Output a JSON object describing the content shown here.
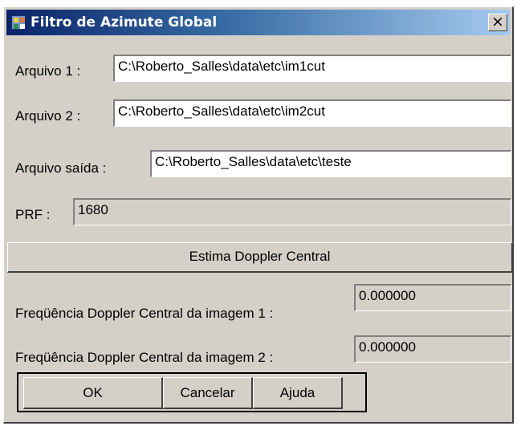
{
  "window": {
    "title": "Filtro de Azimute Global",
    "close_label": "×"
  },
  "form": {
    "arquivo1_label": "Arquivo 1 :",
    "arquivo1_value": "C:\\Roberto_Salles\\data\\etc\\im1cut",
    "arquivo2_label": "Arquivo 2 :",
    "arquivo2_value": "C:\\Roberto_Salles\\data\\etc\\im2cut",
    "saida_label": "Arquivo saída :",
    "saida_value": "C:\\Roberto_Salles\\data\\etc\\teste",
    "prf_label": "PRF :",
    "prf_value": "1680",
    "estima_button": "Estima Doppler Central",
    "freq1_label": "Freqüência Doppler Central da imagem 1 :",
    "freq1_value": "0.000000",
    "freq2_label": "Freqüência Doppler Central da imagem 2 :",
    "freq2_value": "0.000000"
  },
  "buttons": {
    "ok": "OK",
    "cancel": "Cancelar",
    "help": "Ajuda"
  }
}
